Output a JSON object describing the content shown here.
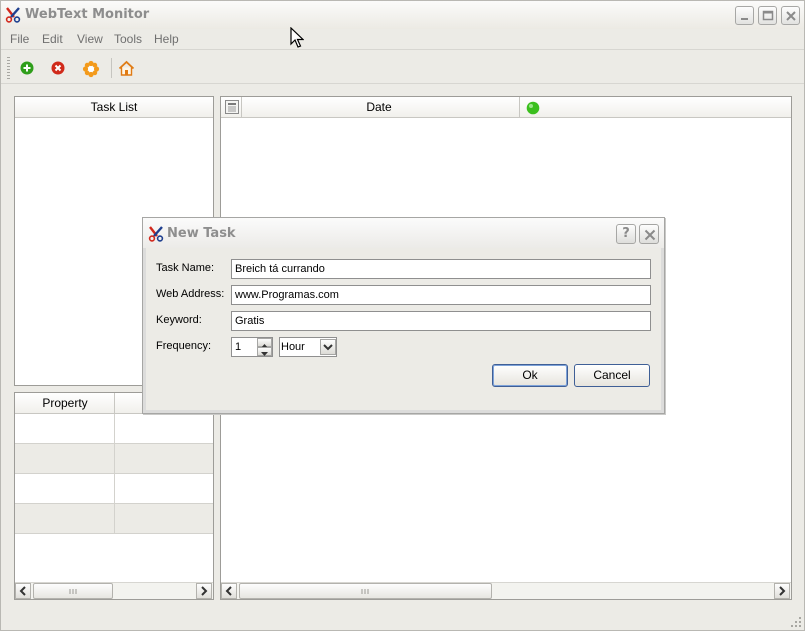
{
  "window": {
    "title": "WebText Monitor"
  },
  "menu": [
    "File",
    "Edit",
    "View",
    "Tools",
    "Help"
  ],
  "toolbar": {
    "icons": [
      "add-icon",
      "delete-icon",
      "settings-icon",
      "home-icon"
    ]
  },
  "panels": {
    "task_list_header": "Task List",
    "property_header": "Property",
    "date_header": "Date"
  },
  "dialog": {
    "title": "New Task",
    "help_label": "?",
    "task_name_label": "Task Name:",
    "task_name_value": "Breich tá currando",
    "web_address_label": "Web Address:",
    "web_address_value": "www.Programas.com",
    "keyword_label": "Keyword:",
    "keyword_value": "Gratis",
    "frequency_label": "Frequency:",
    "frequency_value": "1",
    "frequency_unit": "Hour",
    "ok_label": "Ok",
    "cancel_label": "Cancel"
  },
  "colors": {
    "status_green": "#3bbf1e",
    "add_green": "#2f9e1b",
    "delete_red": "#d02a1a",
    "settings_orange": "#f39a1b",
    "logo_red": "#d2281c",
    "logo_blue": "#1f3f8f"
  }
}
